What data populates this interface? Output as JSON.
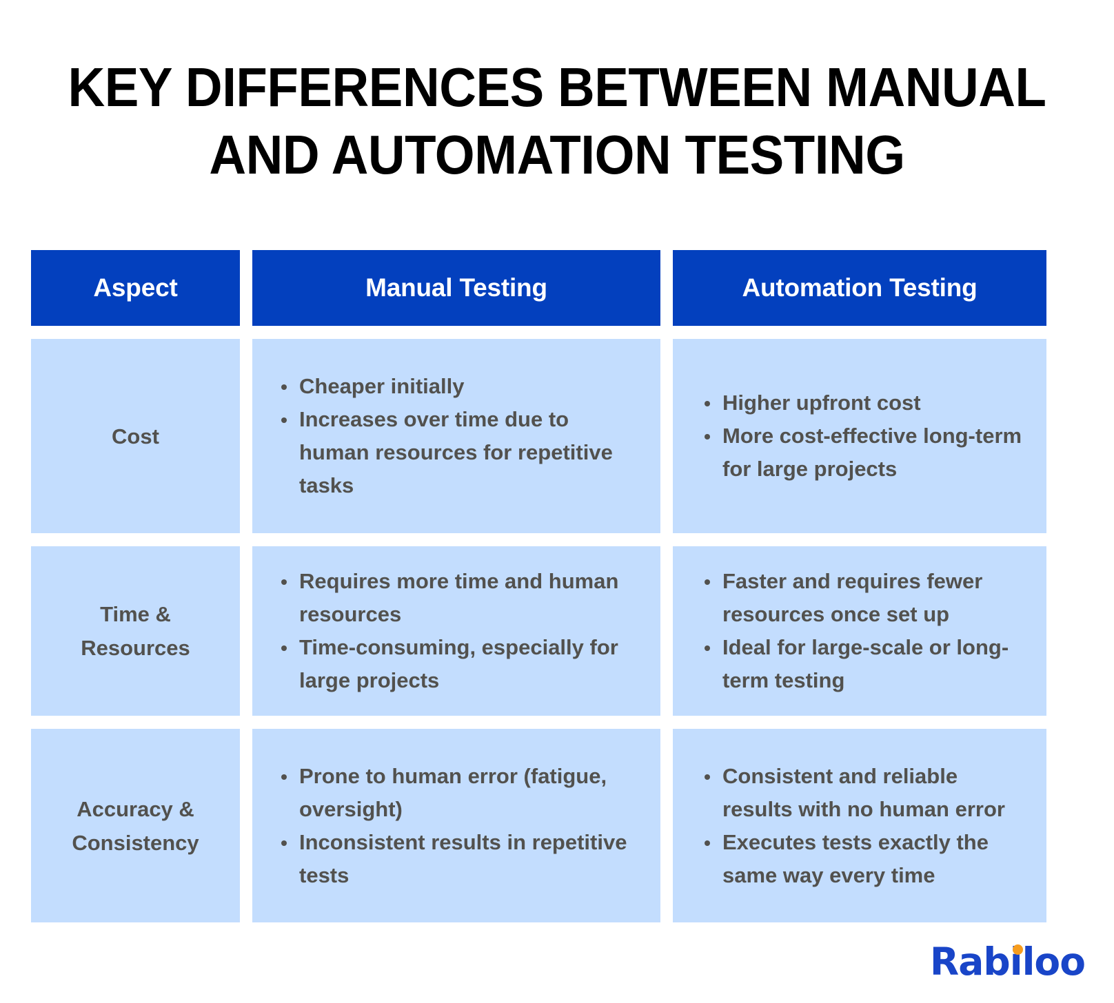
{
  "title": {
    "line1": "KEY DIFFERENCES BETWEEN MANUAL",
    "line2": "AND AUTOMATION TESTING"
  },
  "colors": {
    "header_blue": "#0340be",
    "cell_blue": "#c3ddfe",
    "body_text": "#52514e",
    "title_text": "#000000",
    "logo_blue": "#1945c8",
    "logo_orange": "#f79d1e",
    "page_background": "#ffffff"
  },
  "table": {
    "headers": {
      "aspect": "Aspect",
      "manual": "Manual Testing",
      "automation": "Automation Testing"
    },
    "rows": [
      {
        "aspect": "Cost",
        "manual": [
          "Cheaper initially",
          "Increases over time due to human resources for repetitive tasks"
        ],
        "automation": [
          "Higher upfront cost",
          "More cost-effective long-term for large projects"
        ]
      },
      {
        "aspect": "Time &\nResources",
        "manual": [
          "Requires more time and human resources",
          "Time-consuming, especially for large projects"
        ],
        "automation": [
          "Faster and requires fewer resources once set up",
          "Ideal for large-scale or long-term testing"
        ]
      },
      {
        "aspect": "Accuracy &\nConsistency",
        "manual": [
          "Prone to human error (fatigue, oversight)",
          "Inconsistent results in repetitive tests"
        ],
        "automation": [
          "Consistent and reliable results with no human error",
          "Executes tests exactly the same way every time"
        ]
      }
    ]
  },
  "logo": {
    "name": "Rabiloo"
  }
}
